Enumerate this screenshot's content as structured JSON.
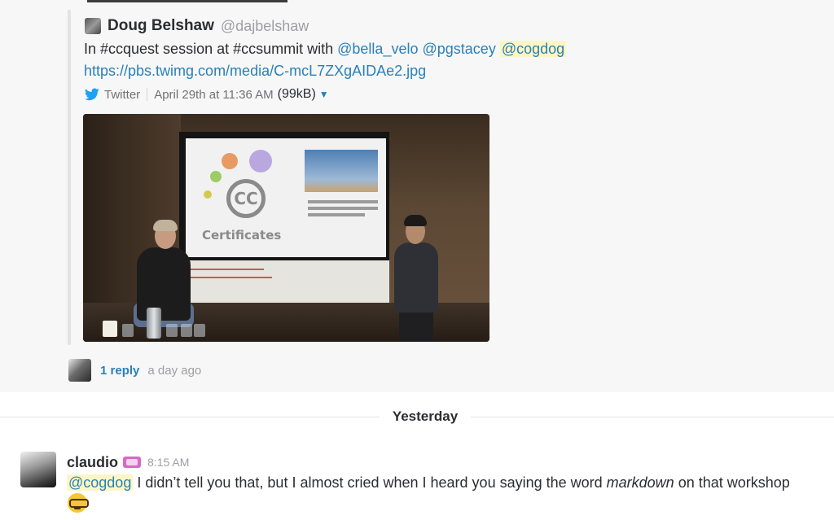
{
  "shared_post": {
    "author_name": "Doug Belshaw",
    "author_handle": "@dajbelshaw",
    "text_prefix": "In #ccquest session at #ccsummit with",
    "mentions": [
      "@bella_velo",
      "@pgstacey",
      "@cogdog"
    ],
    "link": "https://pbs.twimg.com/media/C-mcL7ZXgAIDAe2.jpg",
    "source": "Twitter",
    "timestamp": "April 29th at 11:36 AM",
    "file_size": "(99kB)"
  },
  "slide": {
    "logo_text": "CC",
    "title": "Certificates"
  },
  "thread": {
    "reply_count": "1 reply",
    "reply_time": "a day ago"
  },
  "day_divider": {
    "label": "Yesterday"
  },
  "message": {
    "username": "claudio",
    "time": "8:15 AM",
    "mention": "@cogdog",
    "text_before": " I didn’t tell you that, but I almost cried when I heard you saying the word ",
    "emphasis": "markdown",
    "text_after": " on that workshop",
    "emoji": "nerd-face-emoji"
  },
  "colors": {
    "link": "#2a80b9",
    "mention_highlight": "#fdf6c4",
    "muted": "#9e9ea6",
    "text": "#2c2d30"
  }
}
